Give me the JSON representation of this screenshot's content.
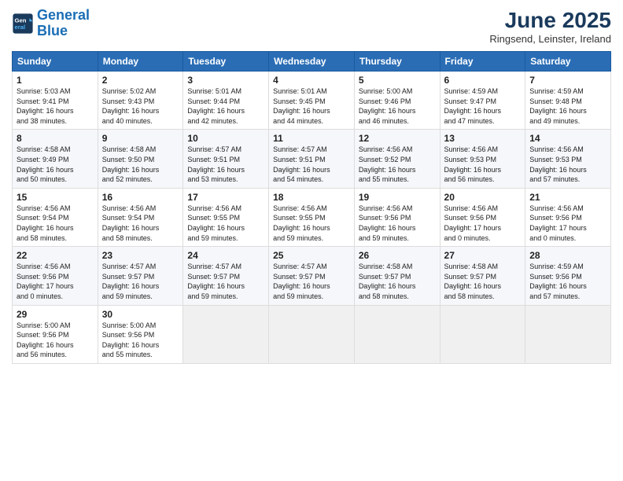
{
  "logo": {
    "line1": "General",
    "line2": "Blue"
  },
  "title": "June 2025",
  "location": "Ringsend, Leinster, Ireland",
  "days_header": [
    "Sunday",
    "Monday",
    "Tuesday",
    "Wednesday",
    "Thursday",
    "Friday",
    "Saturday"
  ],
  "weeks": [
    [
      {
        "day": "1",
        "info": "Sunrise: 5:03 AM\nSunset: 9:41 PM\nDaylight: 16 hours\nand 38 minutes."
      },
      {
        "day": "2",
        "info": "Sunrise: 5:02 AM\nSunset: 9:43 PM\nDaylight: 16 hours\nand 40 minutes."
      },
      {
        "day": "3",
        "info": "Sunrise: 5:01 AM\nSunset: 9:44 PM\nDaylight: 16 hours\nand 42 minutes."
      },
      {
        "day": "4",
        "info": "Sunrise: 5:01 AM\nSunset: 9:45 PM\nDaylight: 16 hours\nand 44 minutes."
      },
      {
        "day": "5",
        "info": "Sunrise: 5:00 AM\nSunset: 9:46 PM\nDaylight: 16 hours\nand 46 minutes."
      },
      {
        "day": "6",
        "info": "Sunrise: 4:59 AM\nSunset: 9:47 PM\nDaylight: 16 hours\nand 47 minutes."
      },
      {
        "day": "7",
        "info": "Sunrise: 4:59 AM\nSunset: 9:48 PM\nDaylight: 16 hours\nand 49 minutes."
      }
    ],
    [
      {
        "day": "8",
        "info": "Sunrise: 4:58 AM\nSunset: 9:49 PM\nDaylight: 16 hours\nand 50 minutes."
      },
      {
        "day": "9",
        "info": "Sunrise: 4:58 AM\nSunset: 9:50 PM\nDaylight: 16 hours\nand 52 minutes."
      },
      {
        "day": "10",
        "info": "Sunrise: 4:57 AM\nSunset: 9:51 PM\nDaylight: 16 hours\nand 53 minutes."
      },
      {
        "day": "11",
        "info": "Sunrise: 4:57 AM\nSunset: 9:51 PM\nDaylight: 16 hours\nand 54 minutes."
      },
      {
        "day": "12",
        "info": "Sunrise: 4:56 AM\nSunset: 9:52 PM\nDaylight: 16 hours\nand 55 minutes."
      },
      {
        "day": "13",
        "info": "Sunrise: 4:56 AM\nSunset: 9:53 PM\nDaylight: 16 hours\nand 56 minutes."
      },
      {
        "day": "14",
        "info": "Sunrise: 4:56 AM\nSunset: 9:53 PM\nDaylight: 16 hours\nand 57 minutes."
      }
    ],
    [
      {
        "day": "15",
        "info": "Sunrise: 4:56 AM\nSunset: 9:54 PM\nDaylight: 16 hours\nand 58 minutes."
      },
      {
        "day": "16",
        "info": "Sunrise: 4:56 AM\nSunset: 9:54 PM\nDaylight: 16 hours\nand 58 minutes."
      },
      {
        "day": "17",
        "info": "Sunrise: 4:56 AM\nSunset: 9:55 PM\nDaylight: 16 hours\nand 59 minutes."
      },
      {
        "day": "18",
        "info": "Sunrise: 4:56 AM\nSunset: 9:55 PM\nDaylight: 16 hours\nand 59 minutes."
      },
      {
        "day": "19",
        "info": "Sunrise: 4:56 AM\nSunset: 9:56 PM\nDaylight: 16 hours\nand 59 minutes."
      },
      {
        "day": "20",
        "info": "Sunrise: 4:56 AM\nSunset: 9:56 PM\nDaylight: 17 hours\nand 0 minutes."
      },
      {
        "day": "21",
        "info": "Sunrise: 4:56 AM\nSunset: 9:56 PM\nDaylight: 17 hours\nand 0 minutes."
      }
    ],
    [
      {
        "day": "22",
        "info": "Sunrise: 4:56 AM\nSunset: 9:56 PM\nDaylight: 17 hours\nand 0 minutes."
      },
      {
        "day": "23",
        "info": "Sunrise: 4:57 AM\nSunset: 9:57 PM\nDaylight: 16 hours\nand 59 minutes."
      },
      {
        "day": "24",
        "info": "Sunrise: 4:57 AM\nSunset: 9:57 PM\nDaylight: 16 hours\nand 59 minutes."
      },
      {
        "day": "25",
        "info": "Sunrise: 4:57 AM\nSunset: 9:57 PM\nDaylight: 16 hours\nand 59 minutes."
      },
      {
        "day": "26",
        "info": "Sunrise: 4:58 AM\nSunset: 9:57 PM\nDaylight: 16 hours\nand 58 minutes."
      },
      {
        "day": "27",
        "info": "Sunrise: 4:58 AM\nSunset: 9:57 PM\nDaylight: 16 hours\nand 58 minutes."
      },
      {
        "day": "28",
        "info": "Sunrise: 4:59 AM\nSunset: 9:56 PM\nDaylight: 16 hours\nand 57 minutes."
      }
    ],
    [
      {
        "day": "29",
        "info": "Sunrise: 5:00 AM\nSunset: 9:56 PM\nDaylight: 16 hours\nand 56 minutes."
      },
      {
        "day": "30",
        "info": "Sunrise: 5:00 AM\nSunset: 9:56 PM\nDaylight: 16 hours\nand 55 minutes."
      },
      {
        "day": "",
        "info": ""
      },
      {
        "day": "",
        "info": ""
      },
      {
        "day": "",
        "info": ""
      },
      {
        "day": "",
        "info": ""
      },
      {
        "day": "",
        "info": ""
      }
    ]
  ]
}
